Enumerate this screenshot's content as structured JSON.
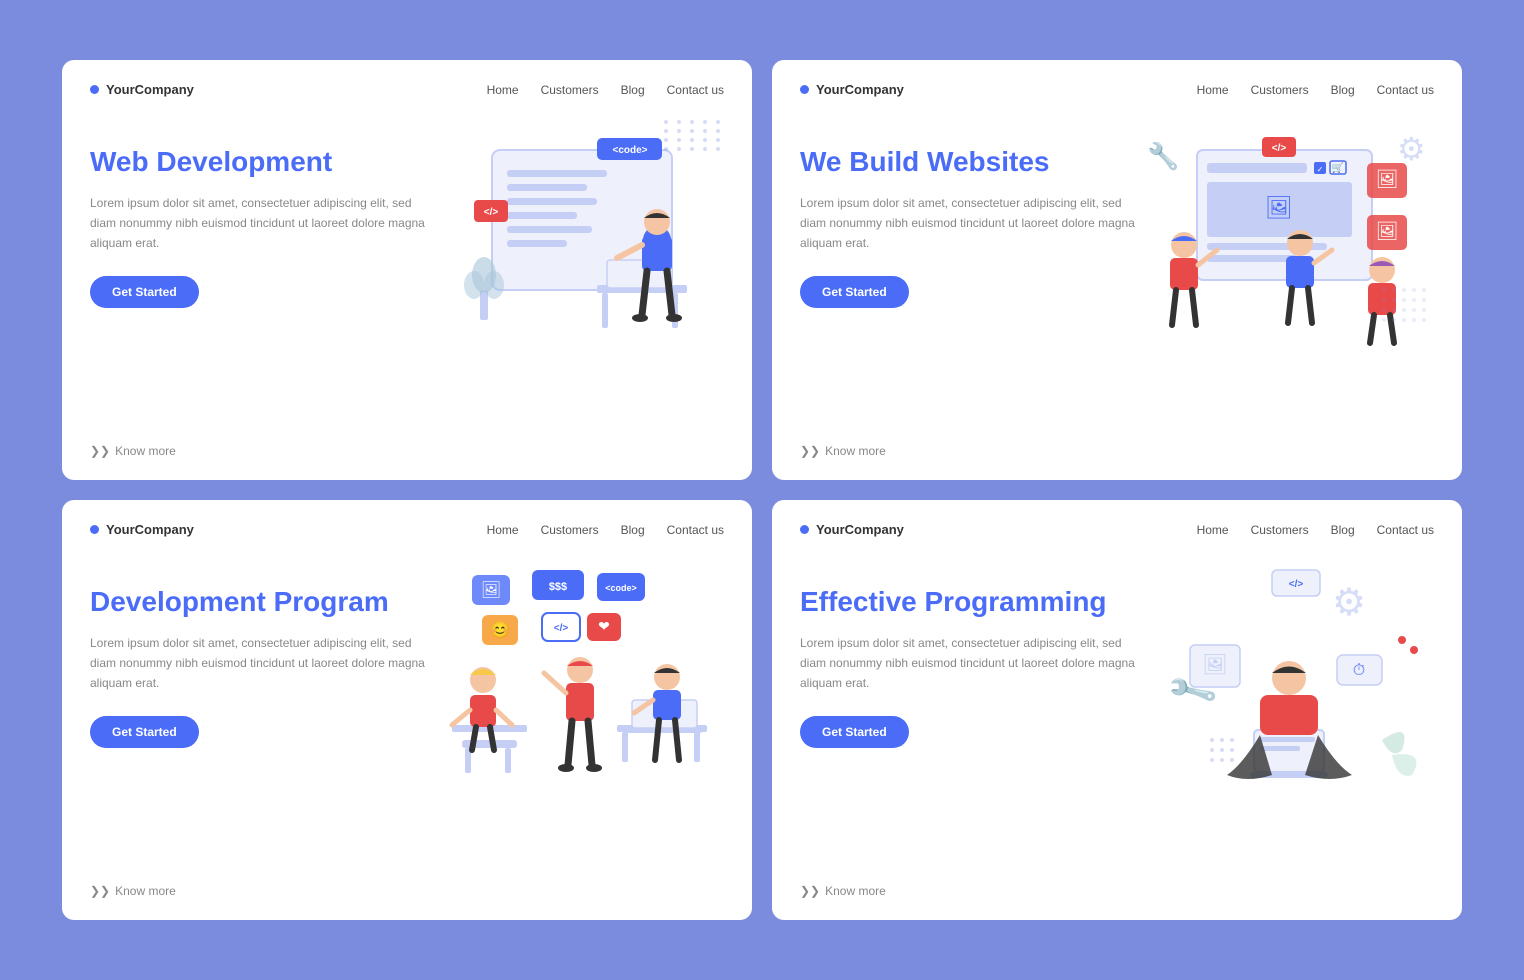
{
  "cards": [
    {
      "id": "web-dev",
      "brand": "YourCompany",
      "nav": [
        "Home",
        "Customers",
        "Blog",
        "Contact us"
      ],
      "title": "Web Development",
      "description": "Lorem ipsum dolor sit amet, consectetuer adipiscing elit, sed diam nonummy nibh euismod tincidunt ut laoreet dolore magna aliquam erat.",
      "cta": "Get Started",
      "knowMore": "Know more",
      "codeBadge": "<code>",
      "redBadge": "</>",
      "illustration": "web-dev"
    },
    {
      "id": "build-websites",
      "brand": "YourCompany",
      "nav": [
        "Home",
        "Customers",
        "Blog",
        "Contact us"
      ],
      "title": "We Build Websites",
      "description": "Lorem ipsum dolor sit amet, consectetuer adipiscing elit, sed diam nonummy nibh euismod tincidunt ut laoreet dolore magna aliquam erat.",
      "cta": "Get Started",
      "knowMore": "Know more",
      "codeBadge": "</>",
      "illustration": "build-websites"
    },
    {
      "id": "dev-program",
      "brand": "YourCompany",
      "nav": [
        "Home",
        "Customers",
        "Blog",
        "Contact us"
      ],
      "title": "Development Program",
      "description": "Lorem ipsum dolor sit amet, consectetuer adipiscing elit, sed diam nonummy nibh euismod tincidunt ut laoreet dolore magna aliquam erat.",
      "cta": "Get Started",
      "knowMore": "Know more",
      "illustration": "dev-program"
    },
    {
      "id": "eff-programming",
      "brand": "YourCompany",
      "nav": [
        "Home",
        "Customers",
        "Blog",
        "Contact us"
      ],
      "title": "Effective Programming",
      "description": "Lorem ipsum dolor sit amet, consectetuer adipiscing elit, sed diam nonummy nibh euismod tincidunt ut laoreet dolore magna aliquam erat.",
      "cta": "Get Started",
      "knowMore": "Know more",
      "codeBadge": "</>",
      "illustration": "eff-programming"
    }
  ],
  "colors": {
    "accent": "#4a6cf7",
    "red": "#e84a4a",
    "bg": "#7b8cde",
    "card": "#ffffff",
    "light": "#c5cff5",
    "lightbg": "#f0f3ff"
  }
}
